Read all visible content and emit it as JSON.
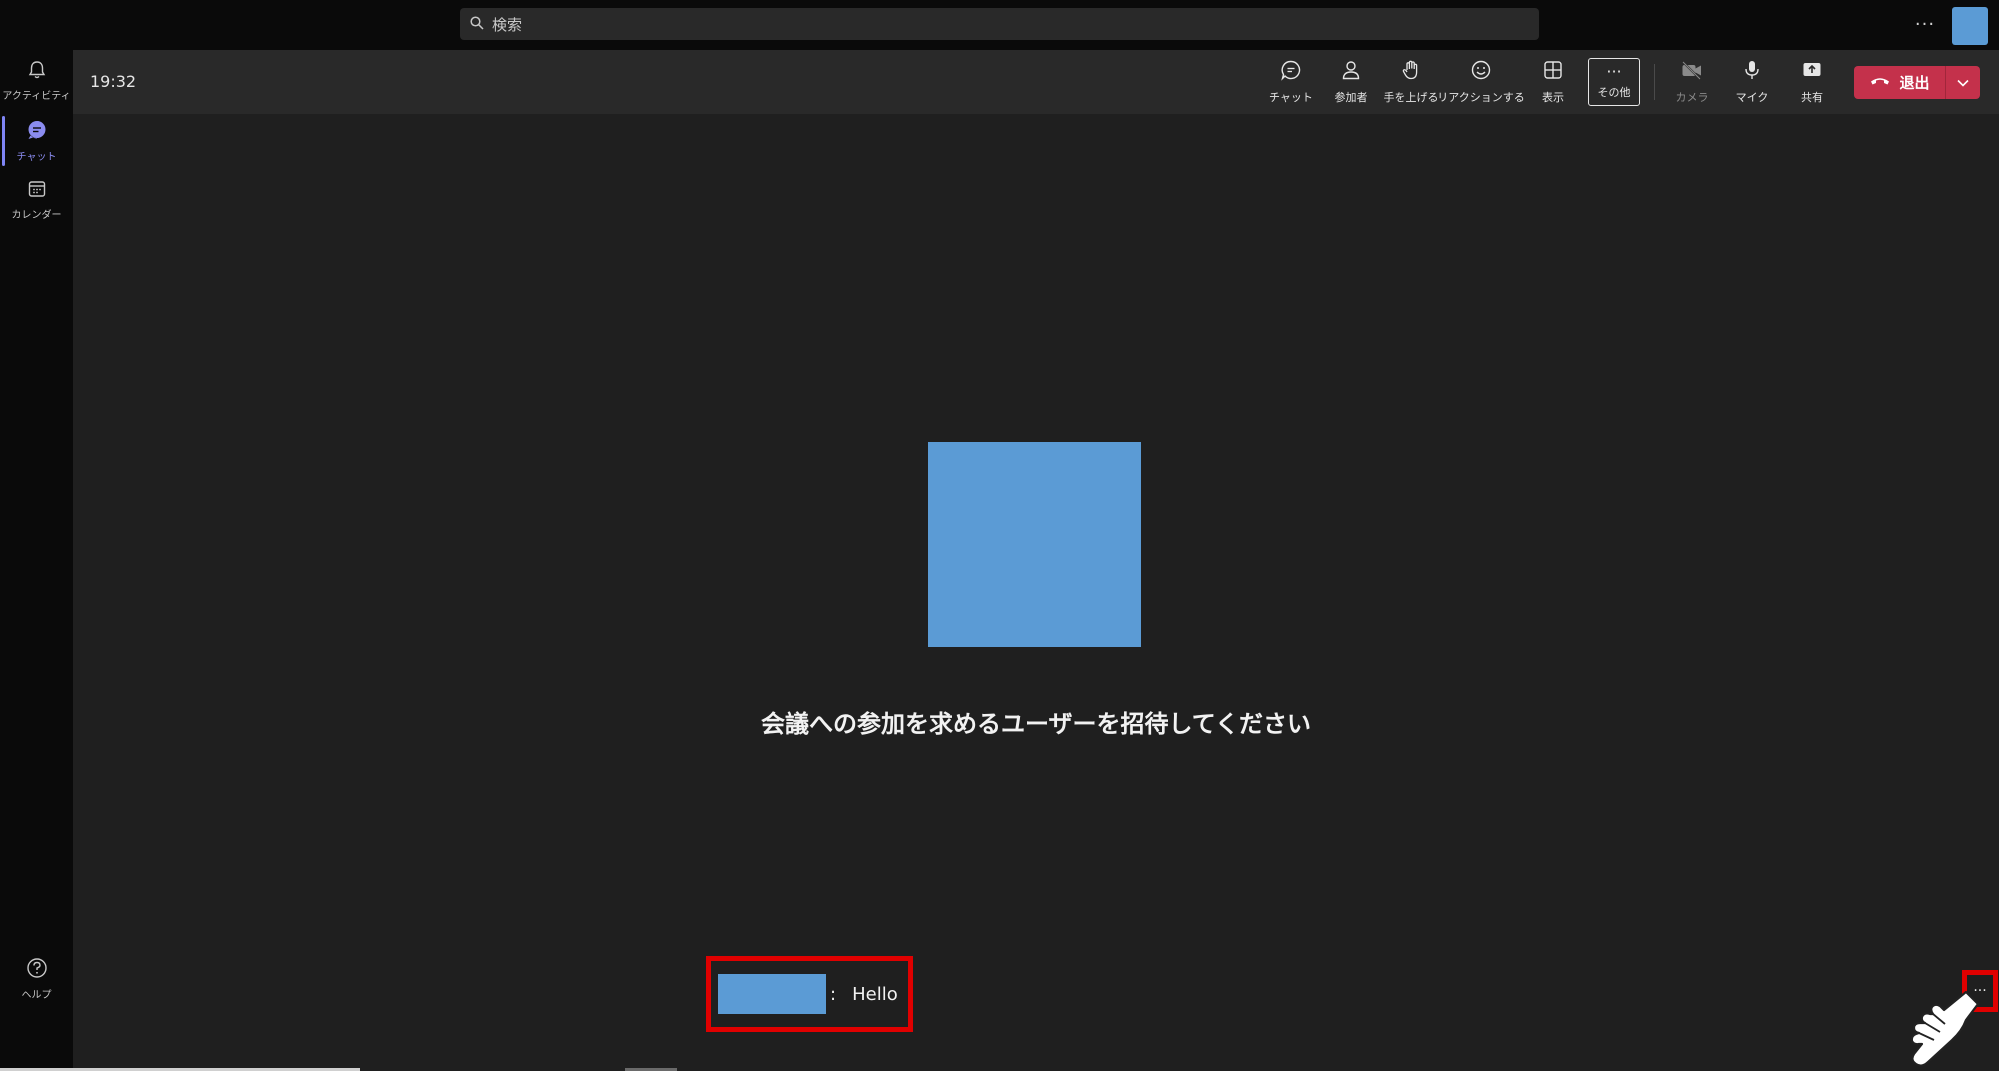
{
  "search": {
    "placeholder": "検索"
  },
  "topbar": {
    "more_label": "···"
  },
  "rail": {
    "items": [
      {
        "label": "アクティビティ",
        "icon": "bell-icon"
      },
      {
        "label": "チャット",
        "icon": "chat-icon",
        "active": true
      },
      {
        "label": "カレンダー",
        "icon": "calendar-icon"
      }
    ],
    "help_label": "ヘルプ"
  },
  "meeting": {
    "time": "19:32",
    "tools": [
      {
        "label": "チャット",
        "icon": "chat-icon"
      },
      {
        "label": "参加者",
        "icon": "people-icon"
      },
      {
        "label": "手を上げる",
        "icon": "raise-hand-icon"
      },
      {
        "label": "リアクションする",
        "icon": "smiley-icon"
      },
      {
        "label": "表示",
        "icon": "grid-icon"
      },
      {
        "label": "その他",
        "icon": "more-icon"
      },
      {
        "label": "カメラ",
        "icon": "camera-off-icon"
      },
      {
        "label": "マイク",
        "icon": "mic-icon"
      },
      {
        "label": "共有",
        "icon": "share-icon"
      }
    ],
    "more_glyph": "···",
    "leave_label": "退出"
  },
  "stage": {
    "invite_text": "会議への参加を求めるユーザーを招待してください"
  },
  "chat_bubble": {
    "separator": ":",
    "message": "Hello"
  },
  "bottom_more_label": "···",
  "colors": {
    "accent": "#5b5fc7",
    "leave": "#c4314b",
    "placeholder": "#5b9bd5",
    "highlight": "#e00000"
  }
}
